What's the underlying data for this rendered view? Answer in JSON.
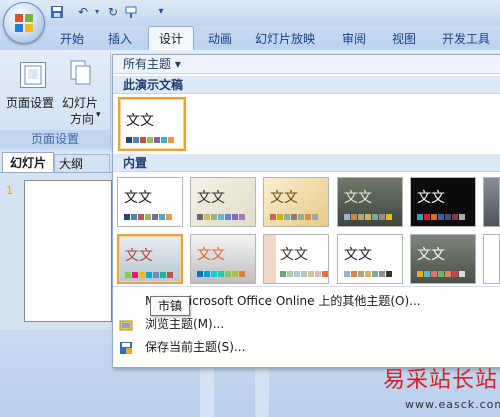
{
  "quick_access": {
    "icons": [
      "save-icon",
      "undo-icon",
      "redo-icon",
      "customize-icon"
    ]
  },
  "tabs": [
    {
      "label": "开始"
    },
    {
      "label": "插入"
    },
    {
      "label": "设计",
      "selected": true
    },
    {
      "label": "动画"
    },
    {
      "label": "幻灯片放映"
    },
    {
      "label": "审阅"
    },
    {
      "label": "视图"
    },
    {
      "label": "开发工具"
    }
  ],
  "ribbon": {
    "page_setup_label": "页面设置",
    "slide_orientation_label_1": "幻灯片",
    "slide_orientation_label_2": "方向",
    "group_label": "页面设置"
  },
  "panel": {
    "tab_slides": "幻灯片",
    "tab_outline": "大纲",
    "slide_number": "1"
  },
  "gallery": {
    "filter_label": "所有主题 ▾",
    "section_current": "此演示文稿",
    "section_builtin": "内置",
    "theme_text": "文文",
    "tooltip": "市镇",
    "menu": {
      "online": "More Microsoft Office Online 上的其他主题(O)...",
      "browse": "浏览主题(M)...",
      "save": "保存当前主题(S)..."
    }
  },
  "colors": {
    "accent": "#e8a33a",
    "ribbon_text": "#15428b"
  },
  "watermark": {
    "cn": "易采站长站",
    "en": "www.easck.com"
  }
}
